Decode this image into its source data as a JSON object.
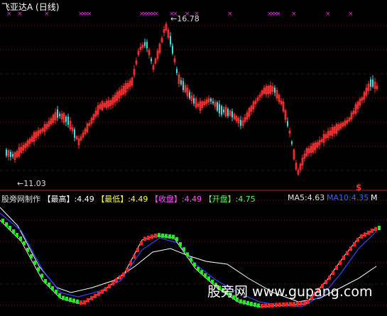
{
  "title": "飞亚达A (日线)",
  "price_chart": {
    "high_label": "16.78",
    "low_label": "11.03",
    "marker_symbol": "$",
    "colors": {
      "up": "#ff3333",
      "down": "#44dddd",
      "marker": "#dd33dd"
    }
  },
  "info_bar": {
    "source": "股旁网制作",
    "high": "【最高】:4.49",
    "low": "【最低】:4.49",
    "close": "【收盘】:4.49",
    "open": "【开盘】:4.75",
    "ma5": "MA5:4.63",
    "ma10": "MA10:4.35",
    "ma10_cut": "M"
  },
  "watermark": "股旁网 www.gupang.com"
}
